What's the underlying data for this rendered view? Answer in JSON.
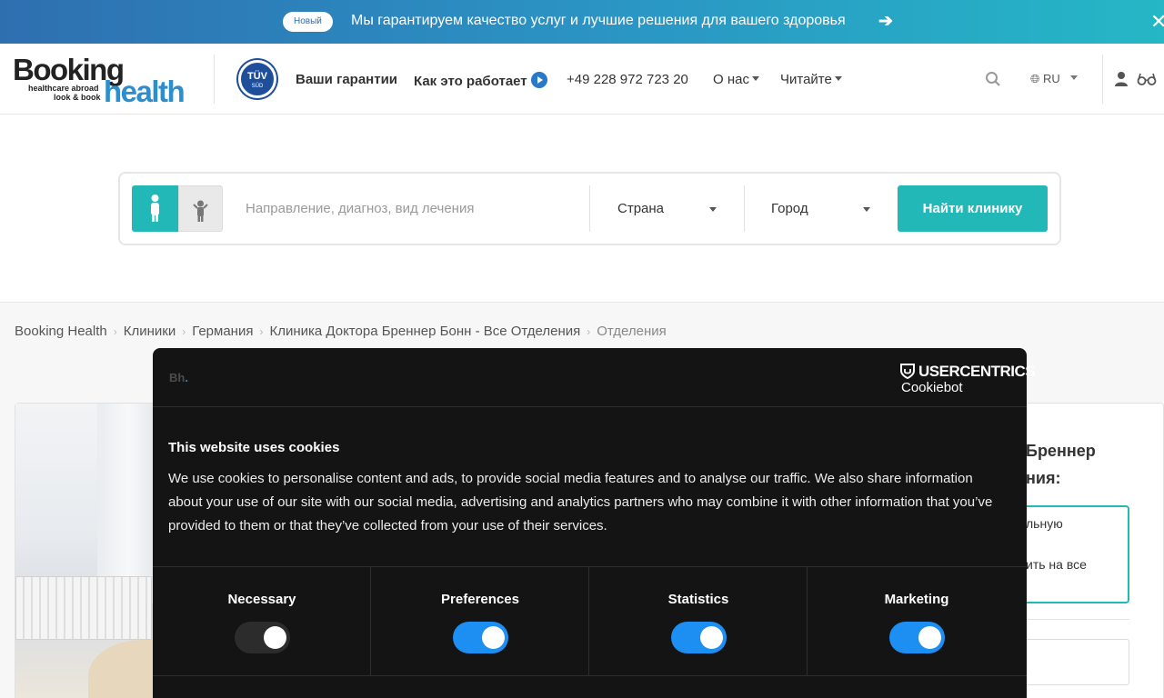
{
  "announcement": {
    "badge": "Новый",
    "message": "Мы гарантируем качество услуг и лучшие решения для вашего здоровья"
  },
  "logo": {
    "word1": "Booking",
    "word2": "health",
    "tagline1": "healthcare abroad",
    "tagline2": "look & book"
  },
  "tuv": {
    "line1": "TÜV",
    "line2": "SÜD"
  },
  "nav": {
    "guarantees": "Ваши гарантии",
    "how_it_works": "Как это работает",
    "phone": "+49 228 972 723 20",
    "about": "О нас",
    "read": "Читайте"
  },
  "language": "RU",
  "search": {
    "placeholder": "Направление, диагноз, вид лечения",
    "country": "Страна",
    "city": "Город",
    "button": "Найти клинику"
  },
  "breadcrumb": [
    "Booking Health",
    "Клиники",
    "Германия",
    "Клиника Доктора Бреннер Бонн - Все Отделения",
    "Отделения"
  ],
  "sidebar": {
    "title_line1": "Бреннер",
    "title_line2": "ния:",
    "option1": "льную",
    "option2": "ить на все"
  },
  "cookie": {
    "brand": "Bh",
    "brand_dot": ".",
    "provider_top": "USERCENTRICS",
    "provider_bottom": "Cookiebot",
    "title": "This website uses cookies",
    "body": "We use cookies to personalise content and ads, to provide social media features and to analyse our traffic. We also share information about your use of our site with our social media, advertising and analytics partners who may combine it with other information that you’ve provided to them or that they’ve collected from your use of their services.",
    "categories": [
      {
        "name": "Necessary",
        "enabled": true,
        "locked": true
      },
      {
        "name": "Preferences",
        "enabled": true,
        "locked": false
      },
      {
        "name": "Statistics",
        "enabled": true,
        "locked": false
      },
      {
        "name": "Marketing",
        "enabled": true,
        "locked": false
      }
    ]
  },
  "colors": {
    "teal": "#23b8b8",
    "toggle_on": "#1e8ff2",
    "dialog_bg": "#141414",
    "brand_blue": "#2a8ecf"
  }
}
